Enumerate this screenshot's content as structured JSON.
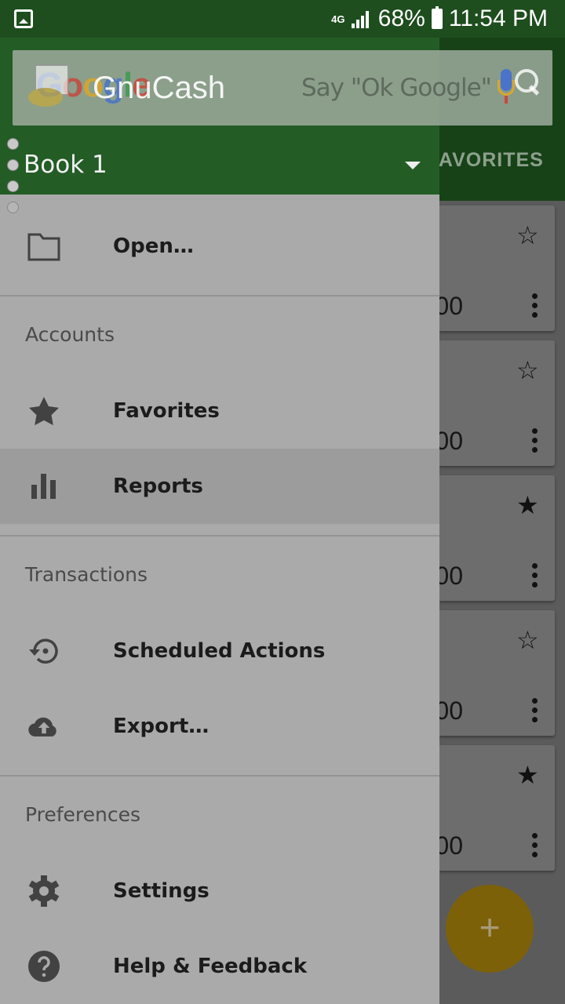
{
  "status_bar": {
    "network": "4G",
    "battery": "68%",
    "time": "11:54 PM"
  },
  "search_widget": {
    "logo": [
      "G",
      "o",
      "o",
      "g",
      "l",
      "e"
    ],
    "hint": "Say \"Ok Google\""
  },
  "app": {
    "name": "GnuCash",
    "tab_visible": "FAVORITES"
  },
  "drawer": {
    "book": "Book 1",
    "open_label": "Open…",
    "sections": {
      "accounts": "Accounts",
      "transactions": "Transactions",
      "preferences": "Preferences"
    },
    "items": {
      "favorites": "Favorites",
      "reports": "Reports",
      "scheduled": "Scheduled Actions",
      "export": "Export…",
      "settings": "Settings",
      "help": "Help & Feedback"
    }
  },
  "background_cards": [
    {
      "amount": "00",
      "starred": false
    },
    {
      "amount": "00",
      "starred": false
    },
    {
      "amount": "00",
      "starred": true
    },
    {
      "amount": "00",
      "starred": false
    },
    {
      "amount": "00",
      "starred": true
    }
  ],
  "fab_label": "+"
}
